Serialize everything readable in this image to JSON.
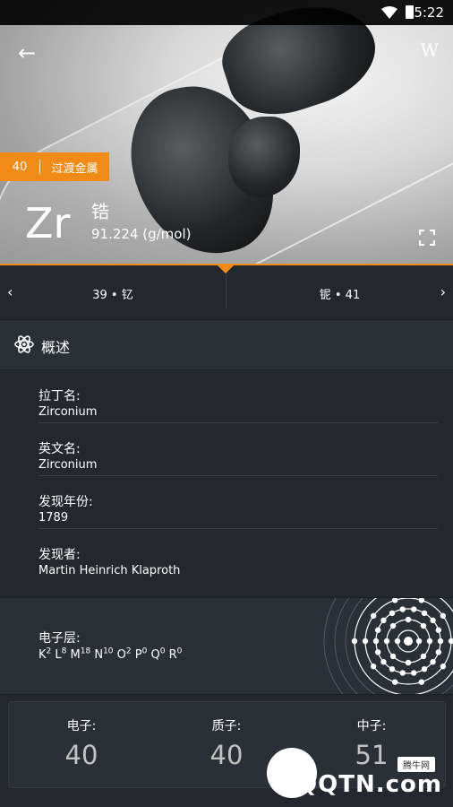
{
  "status": {
    "time": "5:22"
  },
  "header": {
    "atomic_number": "40",
    "category": "过渡金属",
    "symbol": "Zr",
    "name": "锆",
    "mass": "91.224 (g/mol)",
    "wiki_label": "W"
  },
  "nav": {
    "prev_label": "39 • 钇",
    "next_label": "铌 • 41"
  },
  "overview": {
    "title": "概述",
    "rows": [
      {
        "key": "拉丁名:",
        "value": "Zirconium"
      },
      {
        "key": "英文名:",
        "value": "Zirconium"
      },
      {
        "key": "发现年份:",
        "value": "1789"
      },
      {
        "key": "发现者:",
        "value": "Martin Heinrich Klaproth"
      }
    ]
  },
  "shells": {
    "label": "电子层:",
    "items": [
      {
        "letter": "K",
        "count": "2"
      },
      {
        "letter": "L",
        "count": "8"
      },
      {
        "letter": "M",
        "count": "18"
      },
      {
        "letter": "N",
        "count": "10"
      },
      {
        "letter": "O",
        "count": "2"
      },
      {
        "letter": "P",
        "count": "0"
      },
      {
        "letter": "Q",
        "count": "0"
      },
      {
        "letter": "R",
        "count": "0"
      }
    ]
  },
  "counts": {
    "electrons_label": "电子:",
    "electrons": "40",
    "protons_label": "质子:",
    "protons": "40",
    "neutrons_label": "中子:",
    "neutrons": "51"
  },
  "watermark": {
    "tag": "腾牛网",
    "text": "QQTN.com"
  },
  "colors": {
    "accent": "#ef8b16",
    "background": "#24282e",
    "panel": "#2b2f36"
  }
}
